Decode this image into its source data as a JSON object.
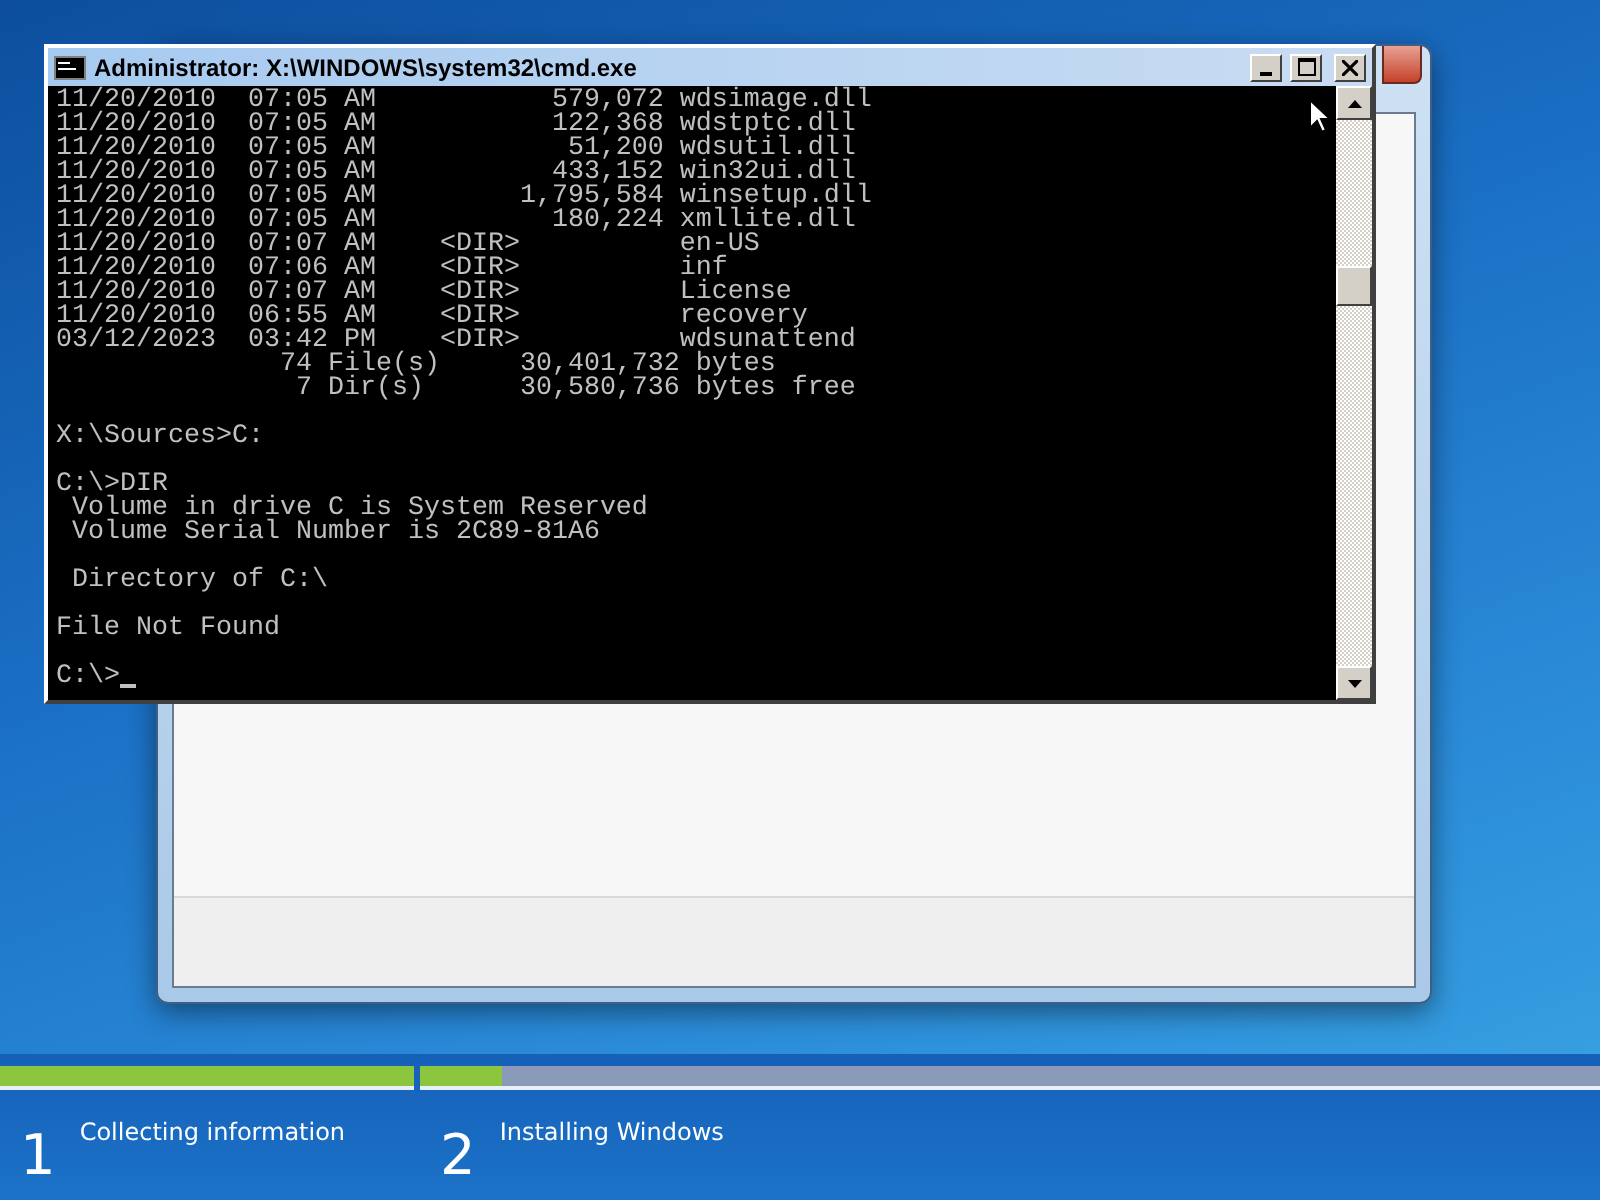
{
  "setup_window": {
    "steps": [
      {
        "number": "1",
        "label": "Collecting information",
        "level": 1
      },
      {
        "number": "2",
        "label": "Installing Windows",
        "level": 0.07
      }
    ]
  },
  "cmd_window": {
    "title": "Administrator: X:\\WINDOWS\\system32\\cmd.exe",
    "blocks": [
      [
        "11/20/2010  07:05 AM           579,072 wdsimage.dll",
        "11/20/2010  07:05 AM           122,368 wdstptc.dll",
        "11/20/2010  07:05 AM            51,200 wdsutil.dll",
        "11/20/2010  07:05 AM           433,152 win32ui.dll",
        "11/20/2010  07:05 AM         1,795,584 winsetup.dll",
        "11/20/2010  07:05 AM           180,224 xmllite.dll",
        "11/20/2010  07:07 AM    <DIR>          en-US",
        "11/20/2010  07:06 AM    <DIR>          inf",
        "11/20/2010  07:07 AM    <DIR>          License",
        "11/20/2010  06:55 AM    <DIR>          recovery",
        "03/12/2023  03:42 PM    <DIR>          wdsunattend",
        "              74 File(s)     30,401,732 bytes",
        "               7 Dir(s)      30,580,736 bytes free"
      ],
      [
        "X:\\Sources>C:"
      ],
      [
        "C:\\>DIR",
        " Volume in drive C is System Reserved",
        " Volume Serial Number is 2C89-81A6"
      ],
      [
        " Directory of C:\\"
      ],
      [
        "File Not Found"
      ],
      [
        "C:\\>"
      ]
    ]
  }
}
